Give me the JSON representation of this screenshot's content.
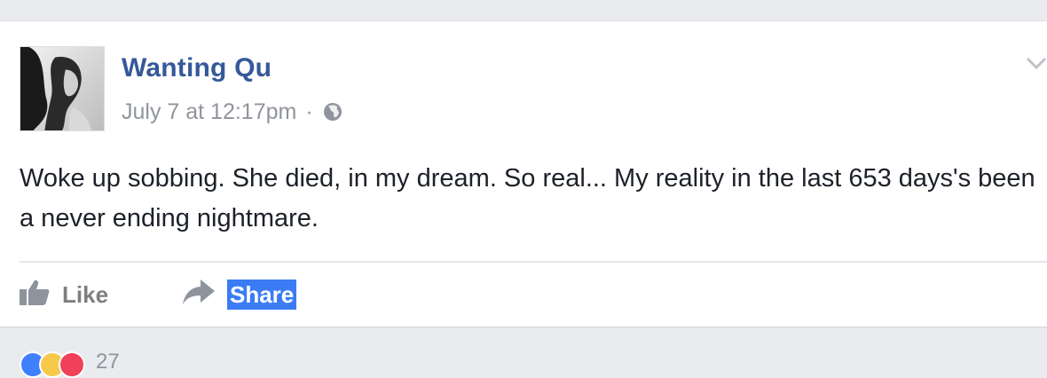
{
  "post": {
    "author": "Wanting Qu",
    "timestamp": "July 7 at 12:17pm",
    "separator": "·",
    "privacy_icon": "globe-icon",
    "text": "Woke up sobbing. She died, in my dream. So real... My reality in the last 653 days's been a never ending nightmare."
  },
  "actions": {
    "like_label": "Like",
    "share_label": "Share"
  },
  "reactions": {
    "icons": [
      "like-reaction-icon",
      "haha-reaction-icon",
      "love-reaction-icon"
    ],
    "count": "27"
  },
  "colors": {
    "author": "#365899",
    "meta": "#90949c",
    "text": "#1d2129",
    "selection": "#3b7cf5"
  }
}
